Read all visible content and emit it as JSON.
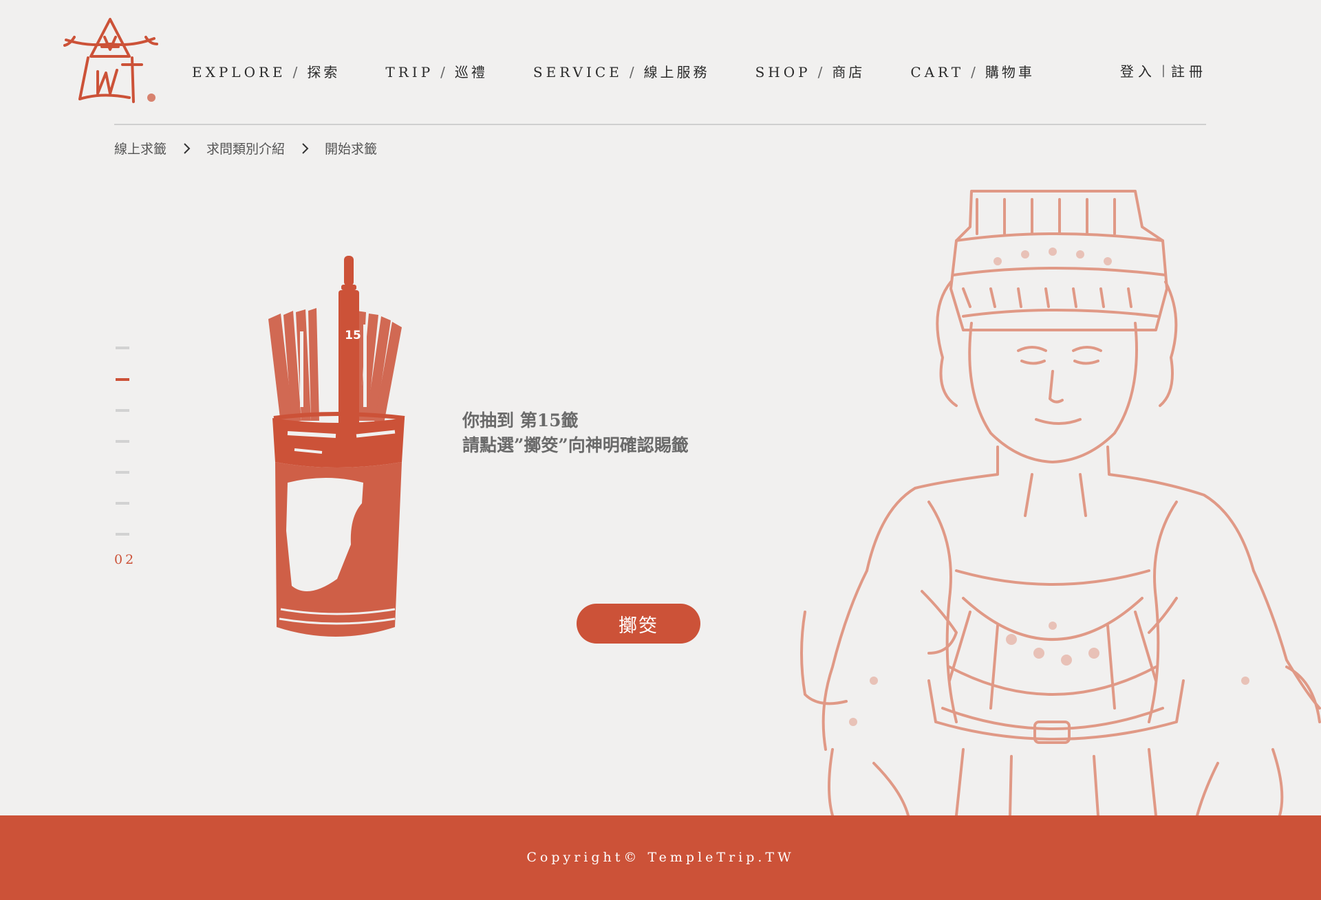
{
  "brand": {
    "logo_icon": "temple-logo-icon",
    "accent_color": "#cc5238"
  },
  "nav": {
    "items": [
      {
        "en": "EXPLORE",
        "zh": "探索"
      },
      {
        "en": "TRIP",
        "zh": "巡禮"
      },
      {
        "en": "SERVICE",
        "zh": "線上服務"
      },
      {
        "en": "SHOP",
        "zh": "商店"
      },
      {
        "en": "CART",
        "zh": "購物車"
      }
    ],
    "separator": "/"
  },
  "auth": {
    "login": "登入",
    "separator": "|",
    "register": "註冊"
  },
  "breadcrumb": {
    "items": [
      "線上求籤",
      "求問類別介紹",
      "開始求籤"
    ]
  },
  "steps": {
    "count": 7,
    "active_index": 1,
    "current_label": "02"
  },
  "fortune": {
    "stick_number": "15",
    "line1": "你抽到  第15籤",
    "line2": "請點選”擲筊”向神明確認賜籤"
  },
  "action": {
    "throw_label": "擲筊"
  },
  "footer": {
    "copyright": "Copyright© TempleTrip.TW"
  }
}
